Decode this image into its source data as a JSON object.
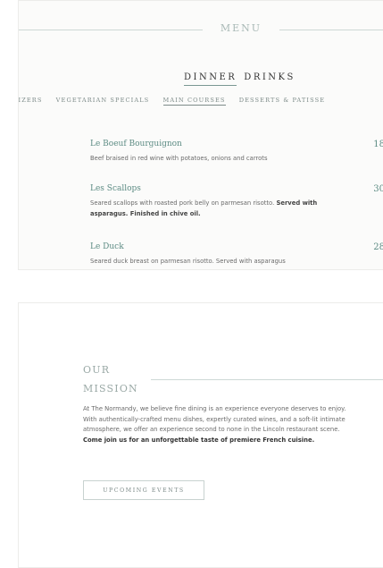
{
  "menu": {
    "title": "MENU",
    "switch": {
      "dinner": "DINNER",
      "drinks": "DRINKS"
    },
    "categories": [
      "PPETIZERS",
      "VEGETARIAN SPECIALS",
      "MAIN COURSES",
      "DESSERTS & PATISSE"
    ],
    "active_category": "MAIN COURSES",
    "dishes": [
      {
        "name": "Le Boeuf Bourguignon",
        "price": "18",
        "desc": "Beef braised in red wine with potatoes, onions and carrots",
        "desc_bold": ""
      },
      {
        "name": "Les Scallops",
        "price": "30",
        "desc": "Seared scallops with roasted pork belly on parmesan risotto.",
        "desc_bold": "Served with asparagus. Finished in chive oil."
      },
      {
        "name": "Le Duck",
        "price": "28",
        "desc": "Seared duck breast on parmesan risotto. Served with asparagus",
        "desc_bold": ""
      }
    ]
  },
  "mission": {
    "title_line1": "OUR",
    "title_line2": "MISSION",
    "text": "At The Normandy, we believe fine dining is an experience everyone deserves to enjoy. With authentically-crafted menu dishes, expertly curated wines, and a soft-lit intimate atmosphere, we offer an experience second to none in the Lincoln restaurant scene.",
    "text_bold": "Come join us for an unforgettable taste of premiere French cuisine.",
    "button_label": "UPCOMING EVENTS"
  }
}
